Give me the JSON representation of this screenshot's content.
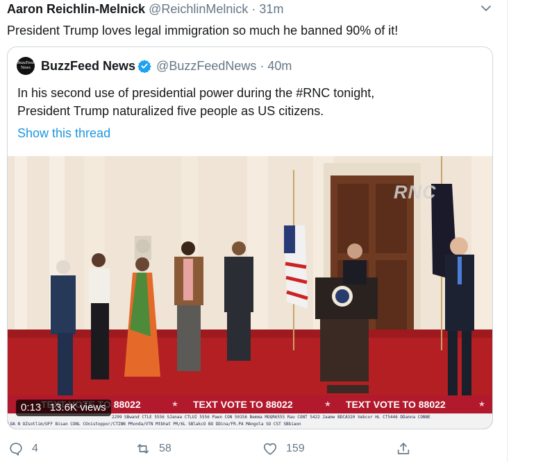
{
  "tweet": {
    "author_name": "Aaron Reichlin-Melnick",
    "author_handle": "@ReichlinMelnick",
    "separator": "·",
    "time": "31m",
    "text": "President Trump loves legal immigration so much he banned 90% of it!"
  },
  "quoted_tweet": {
    "avatar_text": "BuzzFeed News",
    "author_name": "BuzzFeed News",
    "author_handle": "@BuzzFeedNews",
    "separator": "·",
    "time": "40m",
    "text_line1": "In his second use of presidential power during the #RNC tonight,",
    "text_line2": "President Trump naturalized five people as US citizens.",
    "show_thread": "Show this thread",
    "video": {
      "time_badge": "0:13",
      "views_badge": "13.6K views",
      "logo": "RNC",
      "ticker_text": "TEXT VOTE TO 88022",
      "ticker_partial": "TEXT VOTE TO 88022",
      "crawl_line1": "LOA  N  OZsotlim/UFF    Bisan CONL    COnistoppor/CTINN   PRonda/VTN    Mtbhat PR/6L    SBlakcO  BO    DDina/FR.PA    MAngola SO CST    SBbiaon",
      "crawl_line2": "2299  SBwand CTLE 5556  SJanaa CTLUI 5556  Paen CON 50156  Bemma MOQR6555  Rau CONT 5422  Jaame BDCA320  Vebcor HL CT5446  DDanna CONNE",
      "accent_red": "#b2192c"
    }
  },
  "actions": {
    "reply_count": "4",
    "retweet_count": "58",
    "like_count": "159"
  },
  "colors": {
    "link_blue": "#1b95e0",
    "secondary_gray": "#657786",
    "verified_blue": "#1da1f2"
  }
}
